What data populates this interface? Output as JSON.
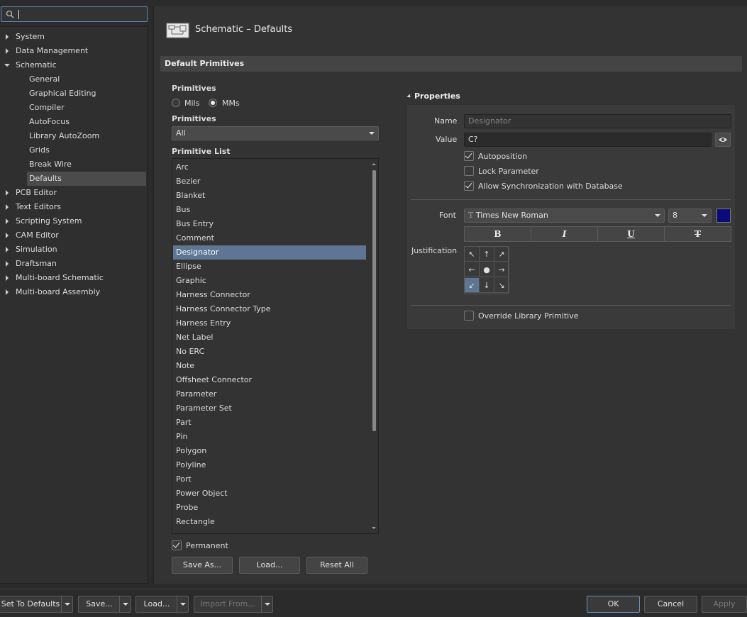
{
  "search": {
    "placeholder": ""
  },
  "tree": [
    {
      "label": "System",
      "state": "collapsed"
    },
    {
      "label": "Data Management",
      "state": "collapsed"
    },
    {
      "label": "Schematic",
      "state": "expanded"
    },
    {
      "label": "General",
      "child": true
    },
    {
      "label": "Graphical Editing",
      "child": true
    },
    {
      "label": "Compiler",
      "child": true
    },
    {
      "label": "AutoFocus",
      "child": true
    },
    {
      "label": "Library AutoZoom",
      "child": true
    },
    {
      "label": "Grids",
      "child": true
    },
    {
      "label": "Break Wire",
      "child": true
    },
    {
      "label": "Defaults",
      "child": true,
      "selected": true
    },
    {
      "label": "PCB Editor",
      "state": "collapsed"
    },
    {
      "label": "Text Editors",
      "state": "collapsed"
    },
    {
      "label": "Scripting System",
      "state": "collapsed"
    },
    {
      "label": "CAM Editor",
      "state": "collapsed"
    },
    {
      "label": "Simulation",
      "state": "collapsed"
    },
    {
      "label": "Draftsman",
      "state": "collapsed"
    },
    {
      "label": "Multi-board Schematic",
      "state": "collapsed"
    },
    {
      "label": "Multi-board Assembly",
      "state": "collapsed"
    }
  ],
  "header": {
    "title": "Schematic – Defaults"
  },
  "section": {
    "title": "Default Primitives"
  },
  "units": {
    "label": "Primitives",
    "mils": "Mils",
    "mms": "MMs",
    "selected": "MMs"
  },
  "filter": {
    "label": "Primitives",
    "value": "All"
  },
  "primitive_list": {
    "label": "Primitive List",
    "items": [
      "Arc",
      "Bezier",
      "Blanket",
      "Bus",
      "Bus Entry",
      "Comment",
      "Designator",
      "Ellipse",
      "Graphic",
      "Harness Connector",
      "Harness Connector Type",
      "Harness Entry",
      "Net Label",
      "No ERC",
      "Note",
      "Offsheet Connector",
      "Parameter",
      "Parameter Set",
      "Part",
      "Pin",
      "Polygon",
      "Polyline",
      "Port",
      "Power Object",
      "Probe",
      "Rectangle"
    ],
    "selected": "Designator"
  },
  "permanent": {
    "label": "Permanent",
    "checked": true
  },
  "list_buttons": {
    "save_as": "Save As...",
    "load": "Load...",
    "reset_all": "Reset All"
  },
  "properties": {
    "title": "Properties",
    "name_label": "Name",
    "name_value": "Designator",
    "value_label": "Value",
    "value_value": "C?",
    "autoposition": {
      "label": "Autoposition",
      "checked": true
    },
    "lock_parameter": {
      "label": "Lock Parameter",
      "checked": false
    },
    "allow_sync": {
      "label": "Allow Synchronization with Database",
      "checked": true
    },
    "font_label": "Font",
    "font_name": "Times New Roman",
    "font_size": "8",
    "font_color": "#0a0a7a",
    "style_buttons": [
      "B",
      "I",
      "U",
      "T"
    ],
    "justification_label": "Justification",
    "justification_glyphs": [
      "↖",
      "↑",
      "↗",
      "←",
      "●",
      "→",
      "↙",
      "↓",
      "↘"
    ],
    "justification_selected": 6,
    "override": {
      "label": "Override Library Primitive",
      "checked": false
    }
  },
  "footer": {
    "set_to_defaults": "Set To Defaults",
    "save": "Save...",
    "load": "Load...",
    "import_from": "Import From...",
    "ok": "OK",
    "cancel": "Cancel",
    "apply": "Apply"
  }
}
